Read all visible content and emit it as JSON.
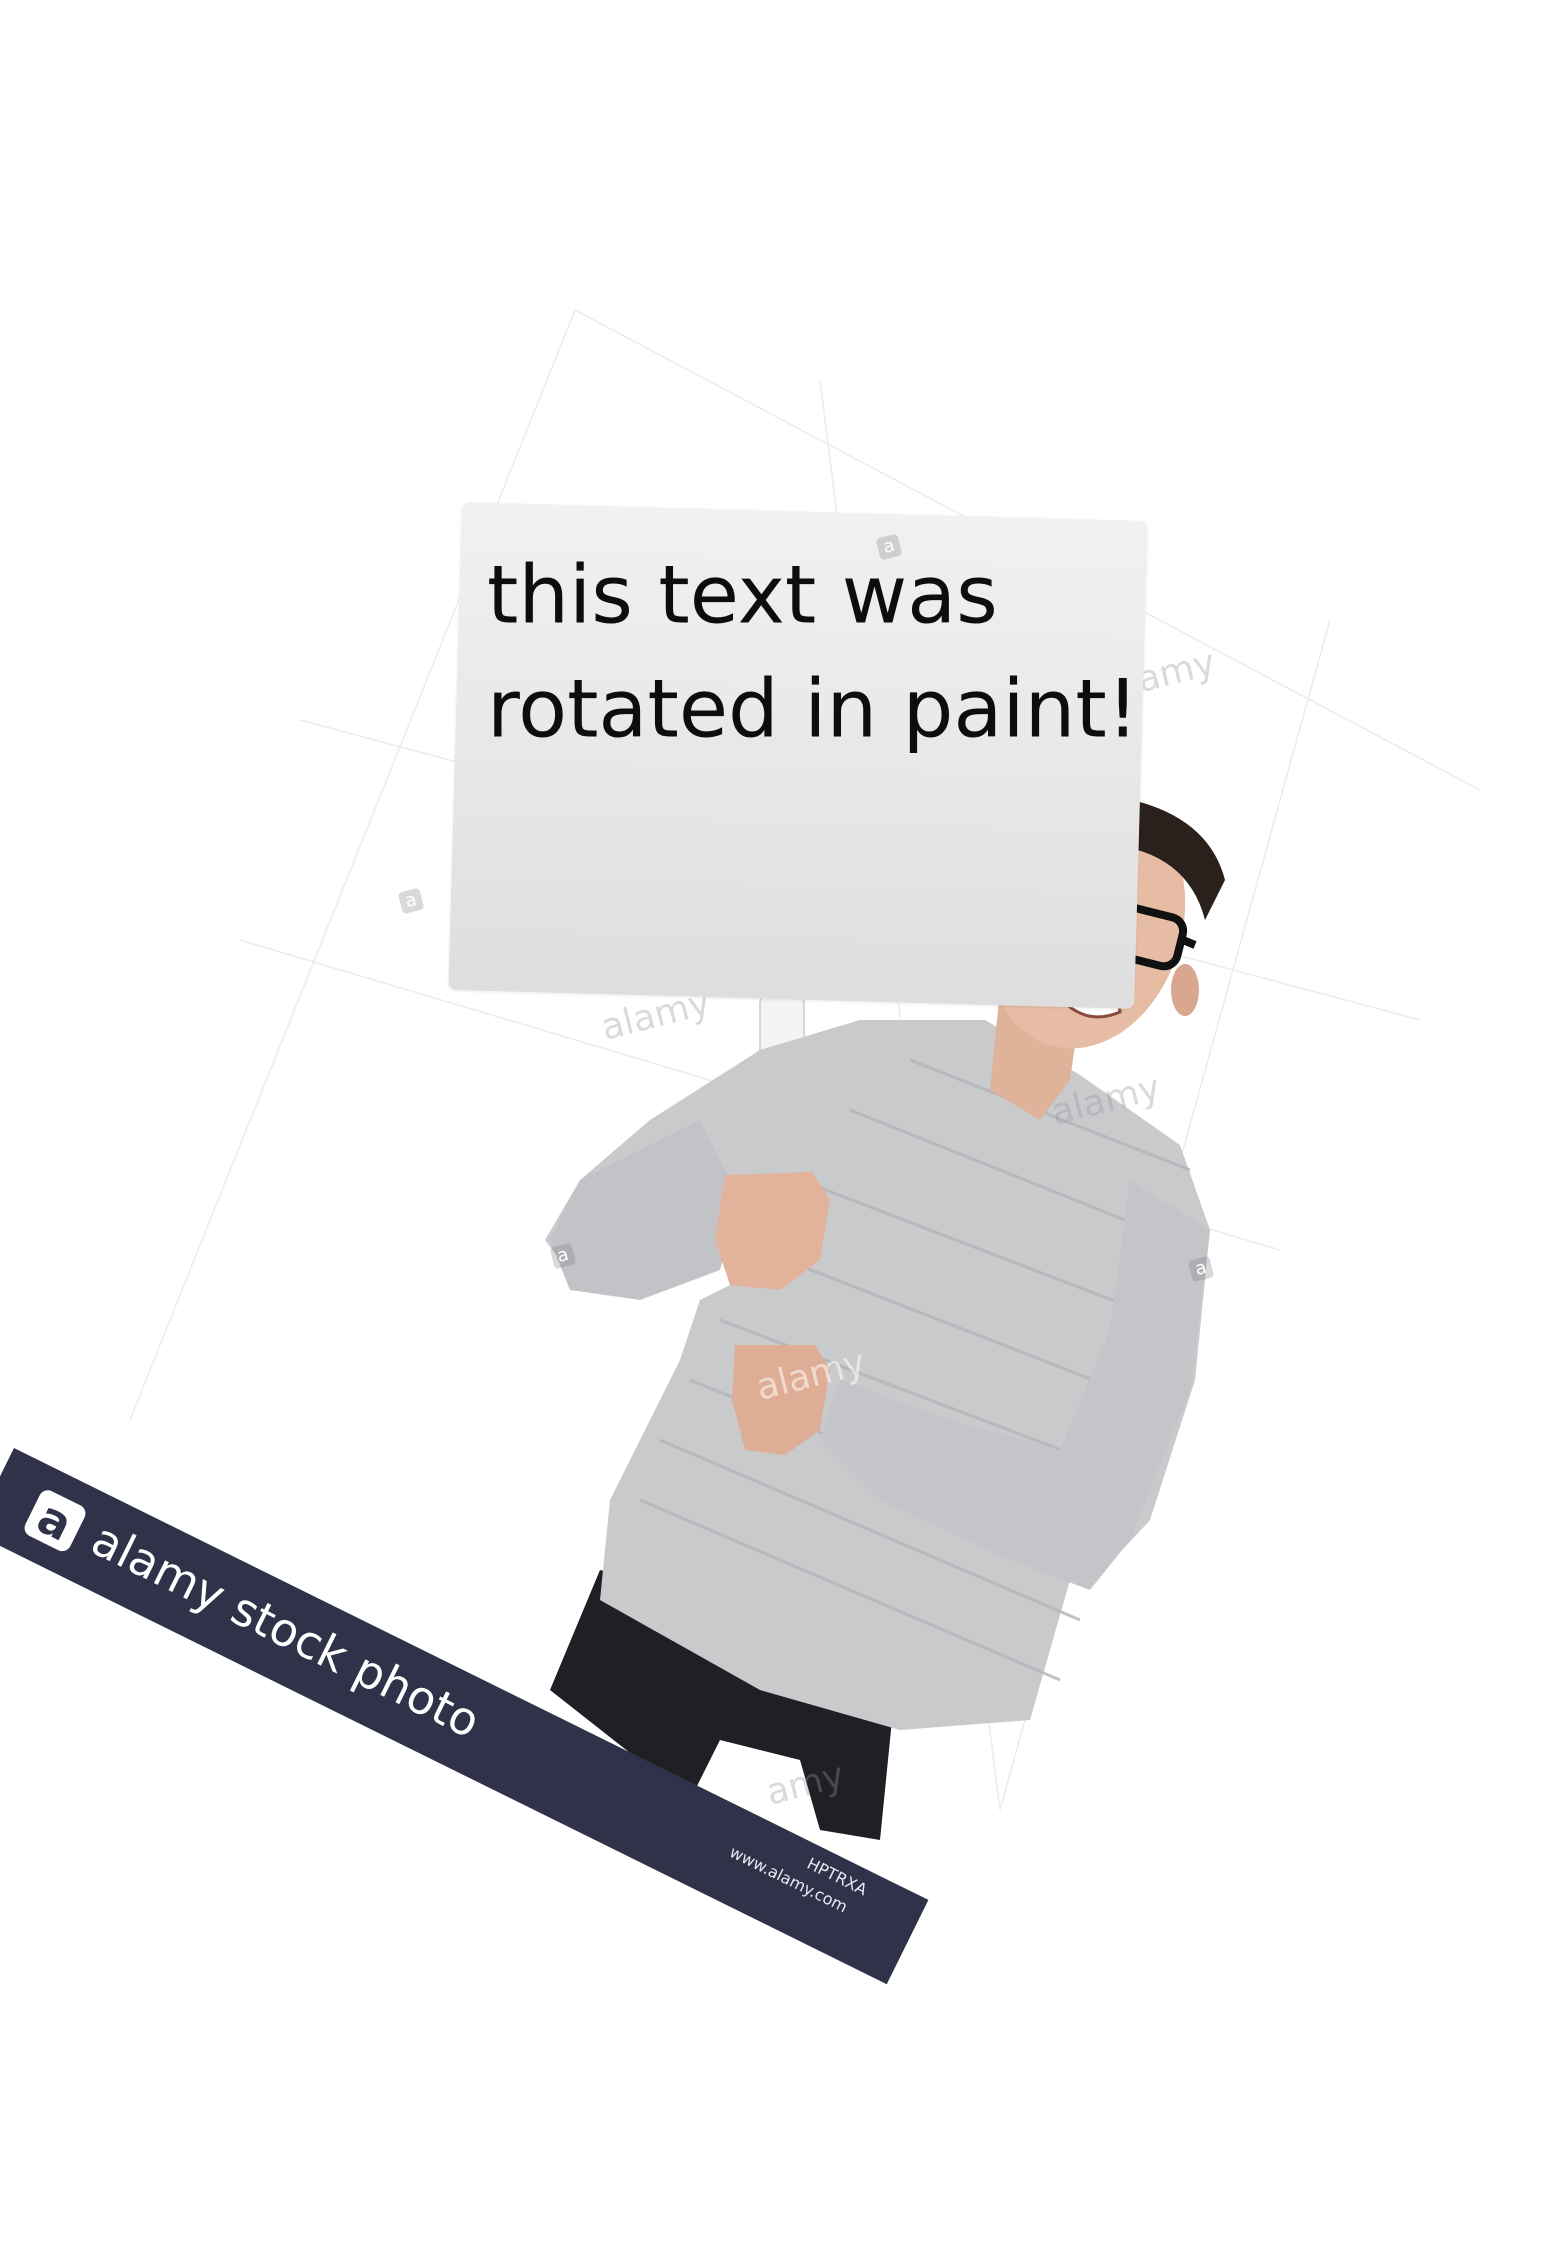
{
  "sign": {
    "text": "this text was\nrotated in paint!"
  },
  "watermark": {
    "brand": "alamy stock photo",
    "logo_letter": "a",
    "image_code": "HPTRXA",
    "url": "www.alamy.com",
    "tile_text": "alamy",
    "band_color": "#30324a"
  }
}
